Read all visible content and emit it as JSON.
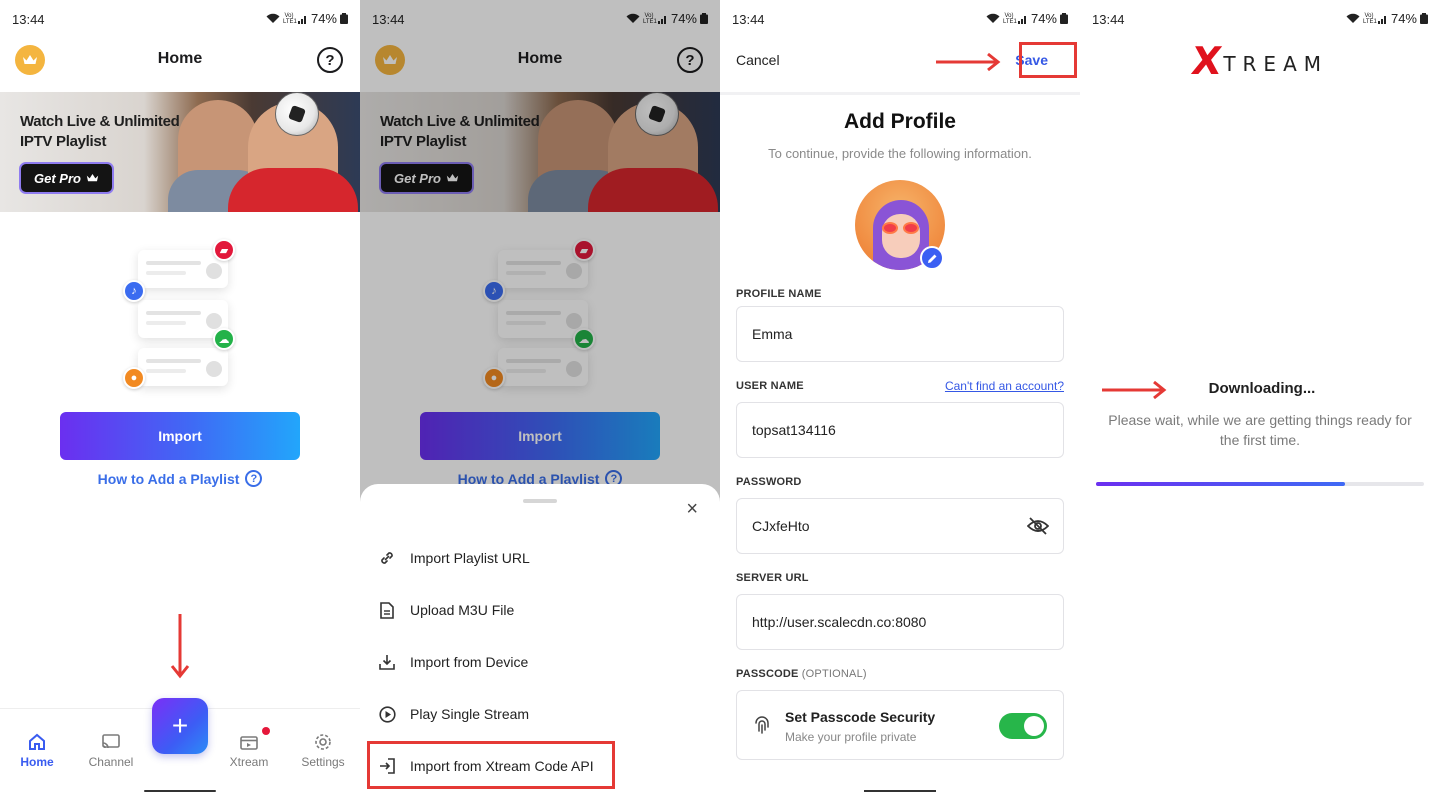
{
  "status": {
    "time": "13:44",
    "battery": "74%",
    "network": "Vo) LTE1"
  },
  "home": {
    "title": "Home",
    "banner": {
      "headline": "Watch Live & Unlimited IPTV Playlist",
      "cta": "Get Pro"
    },
    "import_label": "Import",
    "howto_label": "How to Add a Playlist",
    "nav": [
      {
        "label": "Home",
        "icon": "home-icon",
        "active": true
      },
      {
        "label": "Channel",
        "icon": "cast-icon",
        "active": false
      },
      {
        "label": "Xtream",
        "icon": "clapper-icon",
        "active": false
      },
      {
        "label": "Settings",
        "icon": "gear-icon",
        "active": false
      }
    ],
    "fab_label": "+"
  },
  "import_sheet": {
    "items": [
      {
        "label": "Import Playlist URL",
        "icon": "link-icon"
      },
      {
        "label": "Upload M3U File",
        "icon": "file-icon"
      },
      {
        "label": "Import from Device",
        "icon": "download-icon"
      },
      {
        "label": "Play Single Stream",
        "icon": "play-circle-icon"
      },
      {
        "label": "Import from Xtream Code API",
        "icon": "login-icon"
      }
    ],
    "close_label": "×"
  },
  "profile": {
    "cancel_label": "Cancel",
    "save_label": "Save",
    "title": "Add Profile",
    "subtitle": "To continue, provide the following information.",
    "fields": {
      "profile_name": {
        "label": "PROFILE NAME",
        "value": "Emma"
      },
      "user_name": {
        "label": "USER NAME",
        "value": "topsat134116",
        "helper": "Can't find an account?"
      },
      "password": {
        "label": "PASSWORD",
        "value": "CJxfeHto"
      },
      "server_url": {
        "label": "SERVER URL",
        "value": "http://user.scalecdn.co:8080"
      },
      "passcode": {
        "label": "PASSCODE",
        "optional": "(OPTIONAL)",
        "title": "Set Passcode Security",
        "subtitle": "Make your profile private",
        "enabled": true
      }
    }
  },
  "download": {
    "logo_x": "X",
    "logo_rest": "TREAM",
    "title": "Downloading...",
    "subtitle": "Please wait, while we are getting things ready for the first time.",
    "progress": 0.76
  },
  "colors": {
    "accent": "#3a5cf0",
    "highlight": "#e53935",
    "toggle_on": "#27b64a",
    "brand_red": "#e0121d"
  }
}
